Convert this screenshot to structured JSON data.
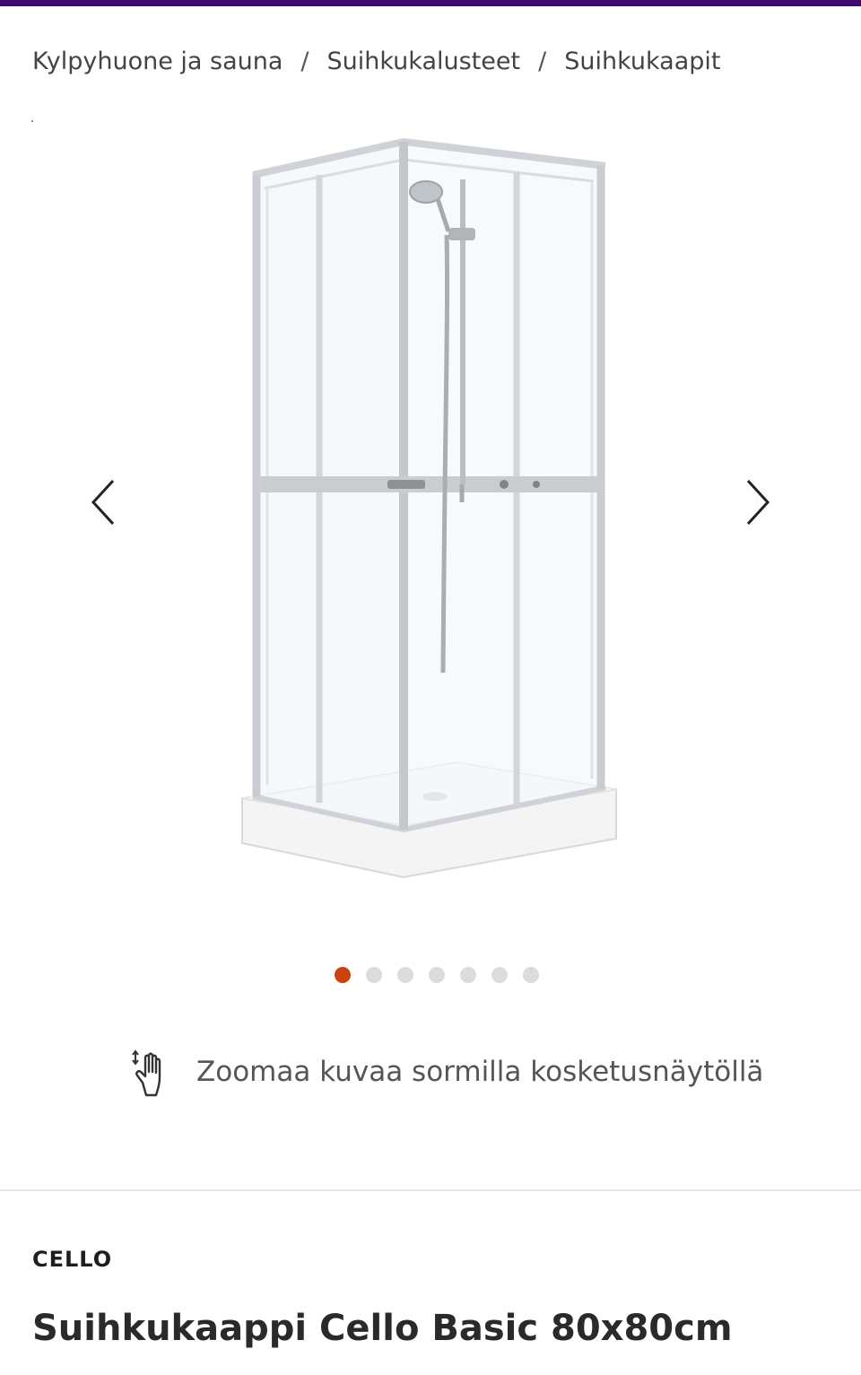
{
  "colors": {
    "top_bar": "#3b0a6b",
    "active_dot": "#c9430c",
    "inactive_dot": "#dcdcdc"
  },
  "breadcrumb": {
    "items": [
      "Kylpyhuone ja sauna",
      "Suihkukalusteet",
      "Suihkukaapit"
    ],
    "separator": "/"
  },
  "gallery": {
    "image_icon": "shower-cabin-image",
    "prev_icon": "chevron-left-icon",
    "next_icon": "chevron-right-icon",
    "total_images": 7,
    "active_index": 0
  },
  "zoom_hint": {
    "icon": "pinch-zoom-hand-icon",
    "text": "Zoomaa kuvaa sormilla kosketusnäytöllä"
  },
  "product": {
    "brand": "CELLO",
    "title": "Suihkukaappi Cello Basic 80x80cm"
  }
}
